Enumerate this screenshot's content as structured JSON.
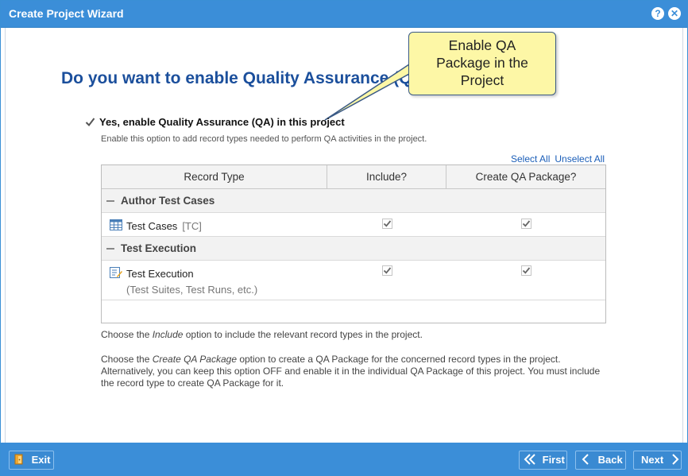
{
  "window": {
    "title": "Create Project Wizard"
  },
  "page": {
    "title": "Do you want to enable Quality Assurance (QA)?"
  },
  "callout": {
    "line1": "Enable QA",
    "line2": "Package in the",
    "line3": "Project"
  },
  "qa_option": {
    "label": "Yes, enable Quality Assurance (QA) in this project",
    "checked": true,
    "description": "Enable this option to add record types needed to perform QA activities in the project."
  },
  "links": {
    "select_all": "Select All",
    "unselect_all": "Unselect All"
  },
  "grid": {
    "columns": [
      "Record Type",
      "Include?",
      "Create QA Package?"
    ],
    "groups": [
      {
        "name": "Author Test Cases",
        "rows": [
          {
            "label": "Test Cases",
            "tag": "[TC]",
            "icon": "table-icon",
            "include": true,
            "create_qa_package": true
          }
        ]
      },
      {
        "name": "Test Execution",
        "rows": [
          {
            "label": "Test Execution",
            "subtext": "(Test Suites, Test Runs, etc.)",
            "icon": "test-execution-icon",
            "include": true,
            "create_qa_package": true
          }
        ]
      }
    ]
  },
  "notes": {
    "include_pre": "Choose the ",
    "include_em": "Include",
    "include_post": " option to include the relevant record types in the project.",
    "qa_pre": "Choose the ",
    "qa_em": "Create QA Package",
    "qa_post": " option to create a QA Package for the concerned record types in the project. Alternatively, you can keep this option OFF and enable it in the individual QA Package of this project. You must include the record type to create QA Package for it."
  },
  "footer": {
    "exit": "Exit",
    "first": "First",
    "back": "Back",
    "next": "Next"
  },
  "colors": {
    "titlebar": "#3b8ed8",
    "heading": "#1b4f9c",
    "callout_bg": "#fdf7a6",
    "link": "#1b5eb8"
  }
}
